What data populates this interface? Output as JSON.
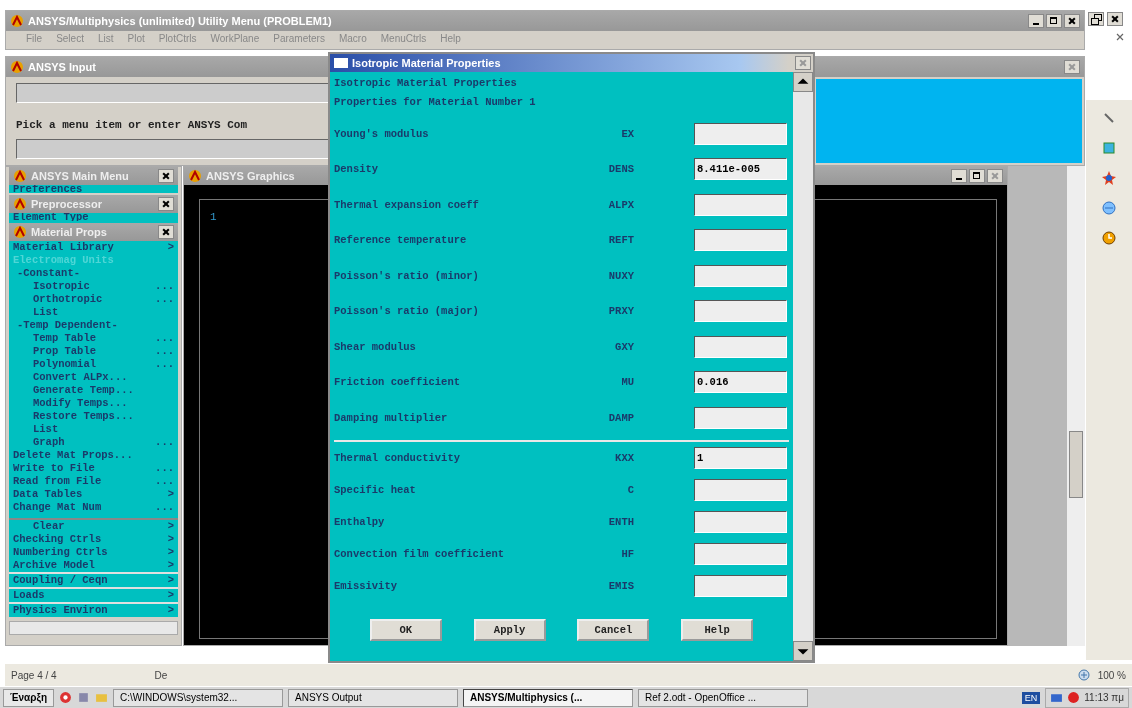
{
  "utility_menu": {
    "title": "ANSYS/Multiphysics (unlimited) Utility Menu (PROBLEM1)",
    "menu": [
      "File",
      "Select",
      "List",
      "Plot",
      "PlotCtrls",
      "WorkPlane",
      "Parameters",
      "Macro",
      "MenuCtrls",
      "Help"
    ]
  },
  "input_window": {
    "title": "ANSYS Input",
    "prompt": "Pick a menu item or enter ANSYS Com"
  },
  "main_menu": {
    "title": "ANSYS Main Menu",
    "top_item": "Preferences",
    "preprocessor": {
      "title": "Preprocessor",
      "top_item": "Element Type",
      "material_props": {
        "title": "Material Props",
        "items": [
          {
            "label": "Material Library",
            "suffix": ">",
            "disabled": false
          },
          {
            "label": "Electromag Units",
            "disabled": true
          },
          {
            "label": "-Constant-",
            "disabled": false,
            "children": [
              {
                "label": "Isotropic",
                "suffix": "..."
              },
              {
                "label": "Orthotropic",
                "suffix": "..."
              },
              {
                "label": "List"
              }
            ]
          },
          {
            "label": "-Temp Dependent-",
            "disabled": false,
            "children": [
              {
                "label": "Temp Table",
                "suffix": "..."
              },
              {
                "label": "Prop Table",
                "suffix": "..."
              },
              {
                "label": "Polynomial",
                "suffix": "..."
              },
              {
                "label": "Convert ALPx..."
              },
              {
                "label": "Generate Temp..."
              },
              {
                "label": "Modify Temps..."
              },
              {
                "label": "Restore Temps..."
              },
              {
                "label": "List"
              },
              {
                "label": "Graph",
                "suffix": "..."
              }
            ]
          },
          {
            "label": "Delete Mat Props...",
            "disabled": false
          },
          {
            "label": "Write to File",
            "suffix": "...",
            "disabled": false
          },
          {
            "label": "Read from File",
            "suffix": "...",
            "disabled": false
          },
          {
            "label": "Data Tables",
            "suffix": ">",
            "disabled": false
          },
          {
            "label": "Change Mat Num",
            "suffix": "...",
            "disabled": false
          }
        ]
      },
      "items": [
        {
          "label": "Clear",
          "suffix": ">"
        },
        {
          "label": "Checking Ctrls",
          "suffix": ">"
        },
        {
          "label": "Numbering Ctrls",
          "suffix": ">"
        },
        {
          "label": "Archive Model",
          "suffix": ">"
        }
      ]
    },
    "items": [
      {
        "label": "Coupling / Ceqn",
        "suffix": ">"
      },
      {
        "label": "Loads",
        "suffix": ">"
      },
      {
        "label": "Physics Environ",
        "suffix": ">"
      }
    ]
  },
  "graphics": {
    "title": "ANSYS Graphics",
    "window_number": "1"
  },
  "dialog": {
    "title": "Isotropic Material Properties",
    "heading": "Isotropic Material Properties",
    "subheading": "Properties for Material Number 1",
    "groups": [
      {
        "fields": [
          {
            "label": "Young's modulus",
            "code": "EX"
          },
          {
            "label": "Density",
            "code": "DENS",
            "value": "8.411e-005"
          },
          {
            "label": "Thermal expansion coeff",
            "code": "ALPX"
          },
          {
            "label": "Reference temperature",
            "code": "REFT"
          },
          {
            "label": "Poisson's ratio (minor)",
            "code": "NUXY"
          },
          {
            "label": "Poisson's ratio (major)",
            "code": "PRXY"
          },
          {
            "label": "Shear modulus",
            "code": "GXY"
          },
          {
            "label": "Friction coefficient",
            "code": "MU",
            "value": "0.016"
          },
          {
            "label": "Damping multiplier",
            "code": "DAMP"
          }
        ]
      },
      {
        "fields": [
          {
            "label": "Thermal conductivity",
            "code": "KXX",
            "value": "1"
          },
          {
            "label": "Specific heat",
            "code": "C"
          },
          {
            "label": "Enthalpy",
            "code": "ENTH"
          },
          {
            "label": "Convection film coefficient",
            "code": "HF"
          },
          {
            "label": "Emissivity",
            "code": "EMIS"
          }
        ]
      }
    ],
    "buttons": [
      "OK",
      "Apply",
      "Cancel",
      "Help"
    ]
  },
  "status_bar": {
    "page": "Page 4 / 4",
    "section": "De",
    "zoom": "100 %"
  },
  "taskbar": {
    "start": "Έναρξη",
    "items": [
      {
        "label": "C:\\WINDOWS\\system32...",
        "selected": false
      },
      {
        "label": "ANSYS Output",
        "selected": false
      },
      {
        "label": "ANSYS/Multiphysics (...",
        "selected": true
      },
      {
        "label": "Ref 2.odt - OpenOffice ...",
        "selected": false
      }
    ],
    "language": "EN",
    "clock": "11:13 πμ"
  }
}
